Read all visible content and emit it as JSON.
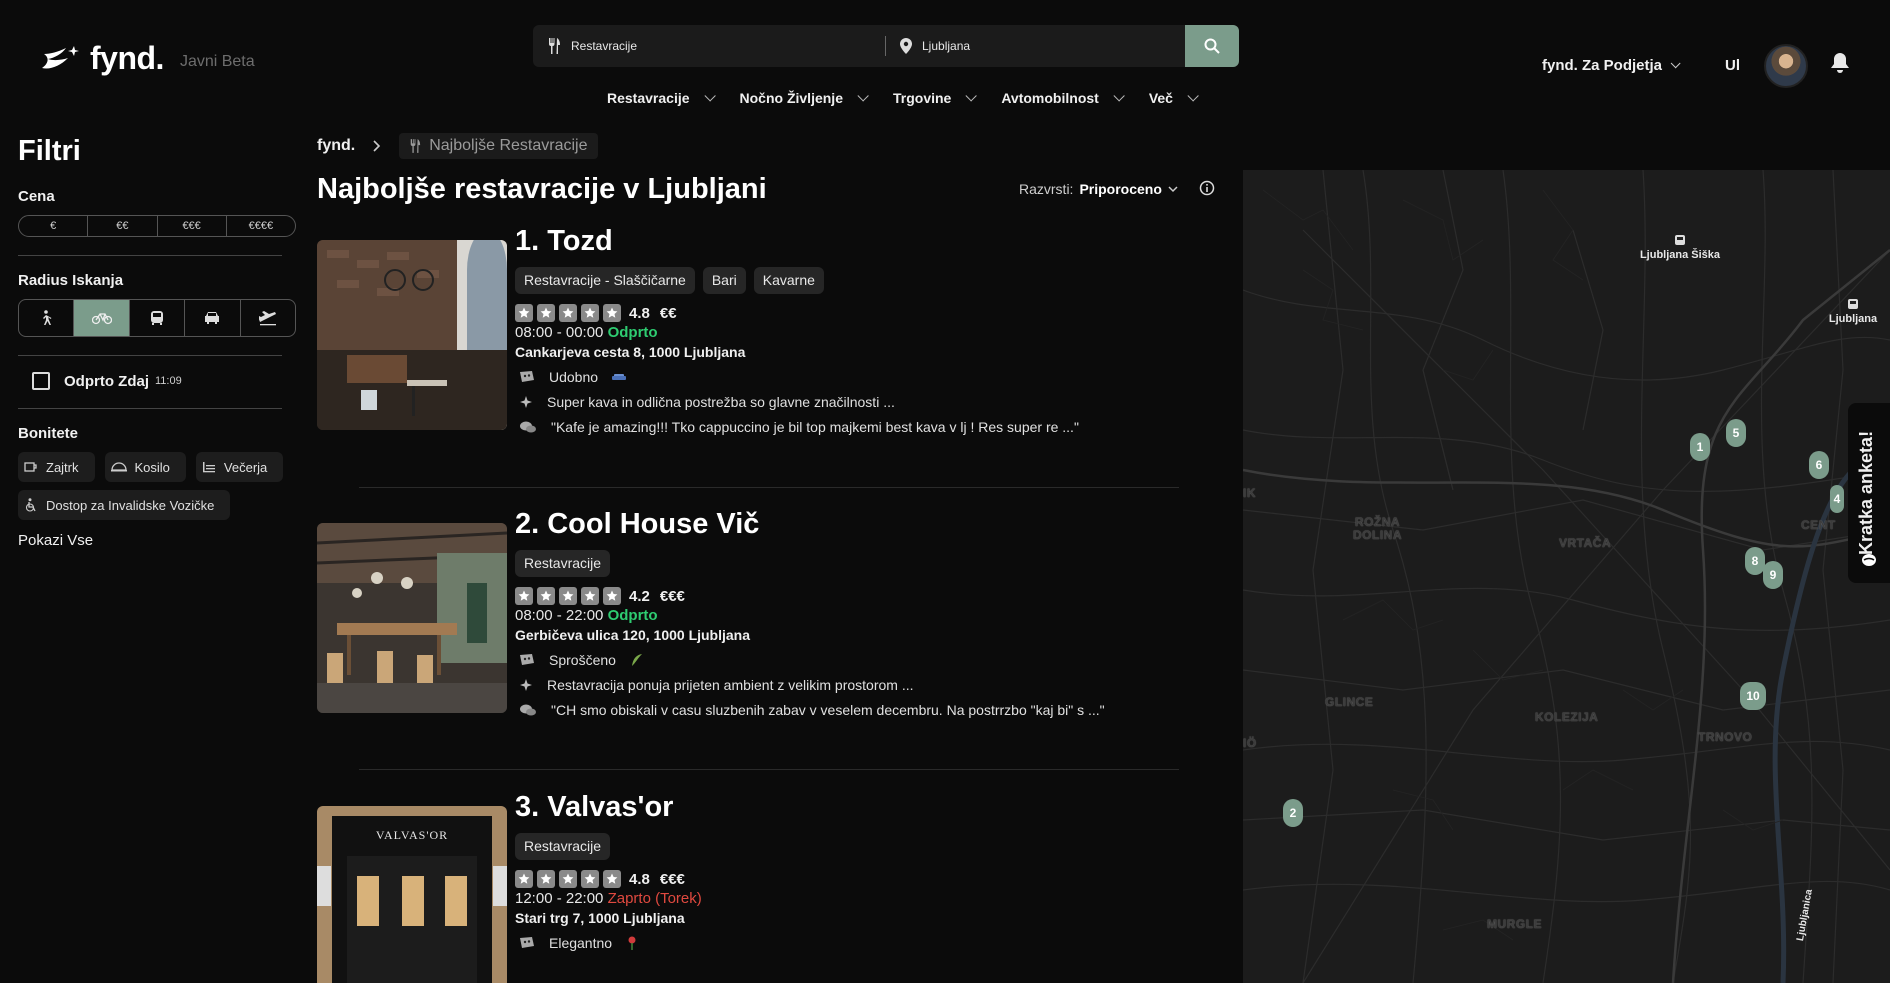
{
  "header": {
    "brand": "fynd.",
    "beta": "Javni Beta",
    "search_query": "Restavracije",
    "search_location": "Ljubljana",
    "business_label": "fynd. Za Podjetja",
    "language": "Ul"
  },
  "nav": [
    {
      "label": "Restavracije"
    },
    {
      "label": "Nočno Življenje"
    },
    {
      "label": "Trgovine"
    },
    {
      "label": "Avtomobilnost"
    },
    {
      "label": "Več"
    }
  ],
  "filters": {
    "title": "Filtri",
    "price_title": "Cena",
    "prices": [
      "€",
      "€€",
      "€€€",
      "€€€€"
    ],
    "radius_title": "Radius Iskanja",
    "radius_icons": [
      "walk-icon",
      "bike-icon",
      "bus-icon",
      "car-icon",
      "plane-icon"
    ],
    "radius_active": "bike-icon",
    "open_now_label": "Odprto Zdaj",
    "open_now_time": "11:09",
    "amenities_title": "Bonitete",
    "amenities": [
      "Zajtrk",
      "Kosilo",
      "Večerja",
      "Dostop za Invalidske Vozičke"
    ],
    "show_all": "Pokazi Vse"
  },
  "breadcrumb": {
    "home": "fynd.",
    "current": "Najboljše Restavracije"
  },
  "page_title": "Najboljše restavracije v Ljubljani",
  "sort": {
    "label": "Razvrsti:",
    "value": "Priporoceno"
  },
  "results": [
    {
      "name": "1. Tozd",
      "tags": [
        "Restavracije - Slaščičarne",
        "Bari",
        "Kavarne"
      ],
      "rating": "4.8",
      "price": "€€",
      "hours": "08:00 - 00:00",
      "status": "Odprto",
      "status_kind": "open",
      "address": "Cankarjeva cesta 8, 1000 Ljubljana",
      "vibe": "Udobno",
      "summary": "Super kava in odlična postrežba so glavne značilnosti ...",
      "review": "\"Kafe je amazing!!! Tko cappuccino je bil top majkemi best kava v lj ! Res super re ...\""
    },
    {
      "name": "2. Cool House Vič",
      "tags": [
        "Restavracije"
      ],
      "rating": "4.2",
      "price": "€€€",
      "hours": "08:00 - 22:00",
      "status": "Odprto",
      "status_kind": "open",
      "address": "Gerbičeva ulica 120, 1000 Ljubljana",
      "vibe": "Sproščeno",
      "summary": "Restavracija ponuja prijeten ambient z velikim prostorom ...",
      "review": "\"CH smo obiskali v casu sluzbenih zabav v veselem decembru. Na postrrzbo \"kaj bi\" s ...\""
    },
    {
      "name": "3. Valvas'or",
      "tags": [
        "Restavracije"
      ],
      "rating": "4.8",
      "price": "€€€",
      "hours": "12:00 - 22:00",
      "status": "Zaprto (Torek)",
      "status_kind": "closed",
      "address": "Stari trg 7, 1000 Ljubljana",
      "vibe": "Elegantno",
      "thumb_sign": "VALVAS'OR"
    }
  ],
  "map": {
    "districts": [
      "ROŽNA",
      "DOLINA",
      "VRTAČA",
      "GLINCE",
      "KOLEZIJA",
      "TRNOVO",
      "MURGLE",
      "CENT",
      "IK",
      "IÖ"
    ],
    "places": [
      "Ljubljana Šiška",
      "Ljubljana",
      "Ljubljanica"
    ],
    "pins": [
      "1",
      "2",
      "4",
      "5",
      "6",
      "8",
      "9",
      "10"
    ]
  },
  "survey_label": "Kratka anketa!",
  "colors": {
    "accent": "#7b9c8b",
    "open": "#2ecc71",
    "closed": "#e0493f",
    "background": "#0b0b0b"
  }
}
